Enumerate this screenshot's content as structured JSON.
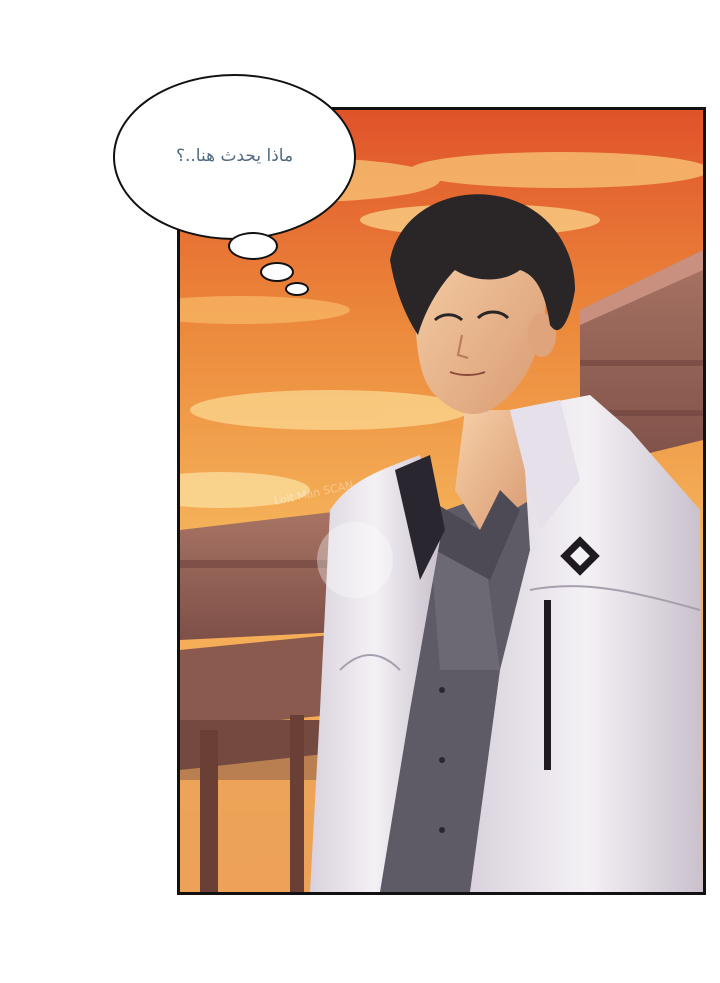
{
  "speech_bubble": {
    "text": "ماذا يحدث هنا..؟"
  },
  "watermark": {
    "text": "Lolt Man SCAN"
  },
  "colors": {
    "sky_top": "#e85a2a",
    "sky_mid": "#f2a24a",
    "sky_bottom": "#f7c36a",
    "jacket": "#f1eef2",
    "shirt": "#5f5b66",
    "hair": "#2a2628",
    "skin": "#f2c49a",
    "building": "#9c6a5a",
    "bubble_text": "#4f6a82"
  }
}
